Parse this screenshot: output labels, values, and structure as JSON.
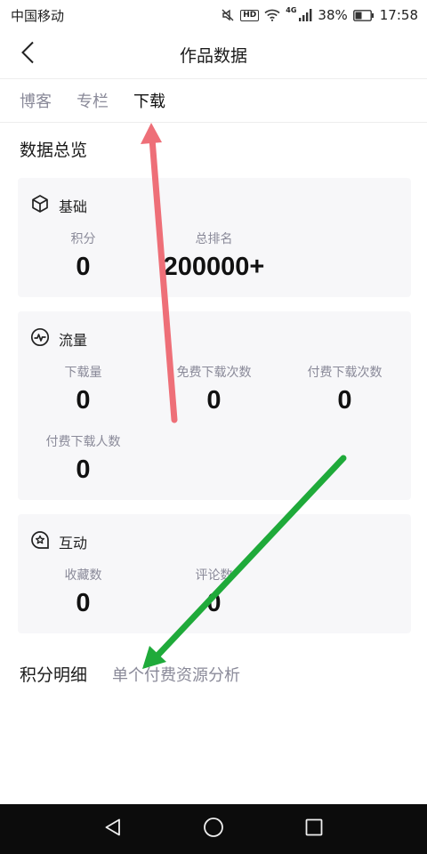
{
  "status_bar": {
    "carrier": "中国移动",
    "hd": "HD",
    "network": "4G",
    "battery": "38%",
    "time": "17:58"
  },
  "header": {
    "title": "作品数据",
    "back_icon": "chevron-left-icon"
  },
  "tabs": [
    {
      "label": "博客",
      "active": false
    },
    {
      "label": "专栏",
      "active": false
    },
    {
      "label": "下载",
      "active": true
    }
  ],
  "overview": {
    "heading": "数据总览",
    "basic": {
      "title": "基础",
      "icon": "cube-icon",
      "stats": [
        {
          "label": "积分",
          "value": "0"
        },
        {
          "label": "总排名",
          "value": "200000+"
        }
      ]
    },
    "traffic": {
      "title": "流量",
      "icon": "pulse-icon",
      "stats": [
        {
          "label": "下载量",
          "value": "0"
        },
        {
          "label": "免费下载次数",
          "value": "0"
        },
        {
          "label": "付费下载次数",
          "value": "0"
        },
        {
          "label": "付费下载人数",
          "value": "0"
        }
      ]
    },
    "interaction": {
      "title": "互动",
      "icon": "star-chat-icon",
      "stats": [
        {
          "label": "收藏数",
          "value": "0"
        },
        {
          "label": "评论数",
          "value": "0"
        }
      ]
    }
  },
  "links": {
    "points_detail": "积分明细",
    "resource_analysis": "单个付费资源分析"
  },
  "colors": {
    "card_bg": "#f7f7f9",
    "muted_text": "#8a8a99",
    "arrow_red": "#ee6f78",
    "arrow_green": "#1faa3a"
  }
}
